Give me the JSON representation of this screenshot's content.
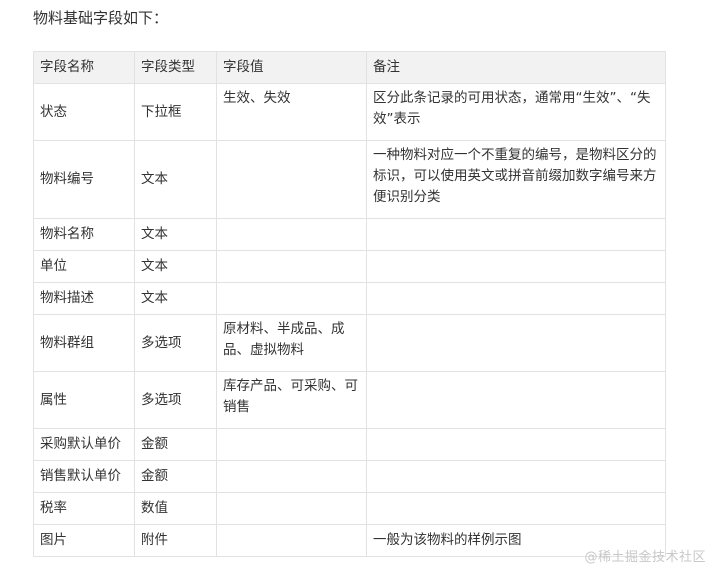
{
  "intro": "物料基础字段如下：",
  "table": {
    "headers": [
      "字段名称",
      "字段类型",
      "字段值",
      "备注"
    ],
    "rows": [
      {
        "name": "状态",
        "type": "下拉框",
        "value": "生效、失效",
        "remark": "区分此条记录的可用状态，通常用“生效”、“失效”表示"
      },
      {
        "name": "物料编号",
        "type": "文本",
        "value": "",
        "remark": "一种物料对应一个不重复的编号，是物料区分的标识，可以使用英文或拼音前缀加数字编号来方便识别分类"
      },
      {
        "name": "物料名称",
        "type": "文本",
        "value": "",
        "remark": ""
      },
      {
        "name": "单位",
        "type": "文本",
        "value": "",
        "remark": ""
      },
      {
        "name": "物料描述",
        "type": "文本",
        "value": "",
        "remark": ""
      },
      {
        "name": "物料群组",
        "type": "多选项",
        "value": "原材料、半成品、成品、虚拟物料",
        "remark": ""
      },
      {
        "name": "属性",
        "type": "多选项",
        "value": "库存产品、可采购、可销售",
        "remark": ""
      },
      {
        "name": "采购默认单价",
        "type": "金额",
        "value": "",
        "remark": ""
      },
      {
        "name": "销售默认单价",
        "type": "金额",
        "value": "",
        "remark": ""
      },
      {
        "name": "税率",
        "type": "数值",
        "value": "",
        "remark": ""
      },
      {
        "name": "图片",
        "type": "附件",
        "value": "",
        "remark": "一般为该物料的样例示图"
      }
    ]
  },
  "watermark": "@稀土掘金技术社区"
}
